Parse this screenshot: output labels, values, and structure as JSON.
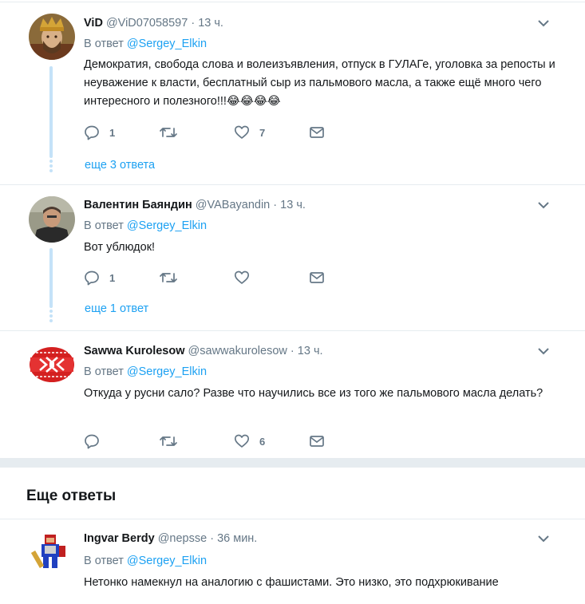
{
  "tweets": [
    {
      "name": "ViD",
      "handle": "@ViD07058597",
      "time": "13 ч.",
      "reply_prefix": "В ответ",
      "reply_to": "@Sergey_Elkin",
      "text": "Демократия, свобода слова и волеизъявления, отпуск в ГУЛАГе, уголовка за репосты и неуважение к власти, бесплатный сыр из пальмового масла, а также ещё много чего интересного и полезного!!!😂😂😂😂",
      "replies": "1",
      "retweets": "",
      "likes": "7",
      "more_replies": "еще 3 ответа"
    },
    {
      "name": "Валентин Баяндин",
      "handle": "@VABayandin",
      "time": "13 ч.",
      "reply_prefix": "В ответ",
      "reply_to": "@Sergey_Elkin",
      "text": "Вот ублюдок!",
      "replies": "1",
      "retweets": "",
      "likes": "",
      "more_replies": "еще 1 ответ"
    },
    {
      "name": "Sawwa Kurolesow",
      "handle": "@sawwakurolesow",
      "time": "13 ч.",
      "reply_prefix": "В ответ",
      "reply_to": "@Sergey_Elkin",
      "text": "Откуда у русни сало?  Разве что научились все из того же пальмового масла делать?",
      "replies": "",
      "retweets": "",
      "likes": "6"
    },
    {
      "name": "Ingvar Berdy",
      "handle": "@nepsse",
      "time": "36 мин.",
      "reply_prefix": "В ответ",
      "reply_to": "@Sergey_Elkin",
      "text": "Нетонко намекнул на аналогию с фашистами. Это низко, это подхрюкивание"
    }
  ],
  "section_title": "Еще ответы",
  "separator": "·",
  "colors": {
    "accent": "#1da1f2",
    "muted": "#657786",
    "thread": "#c4e2f8",
    "divider": "#e6ecf0"
  },
  "icons": [
    "reply-icon",
    "retweet-icon",
    "like-icon",
    "dm-icon",
    "caret-down-icon"
  ]
}
